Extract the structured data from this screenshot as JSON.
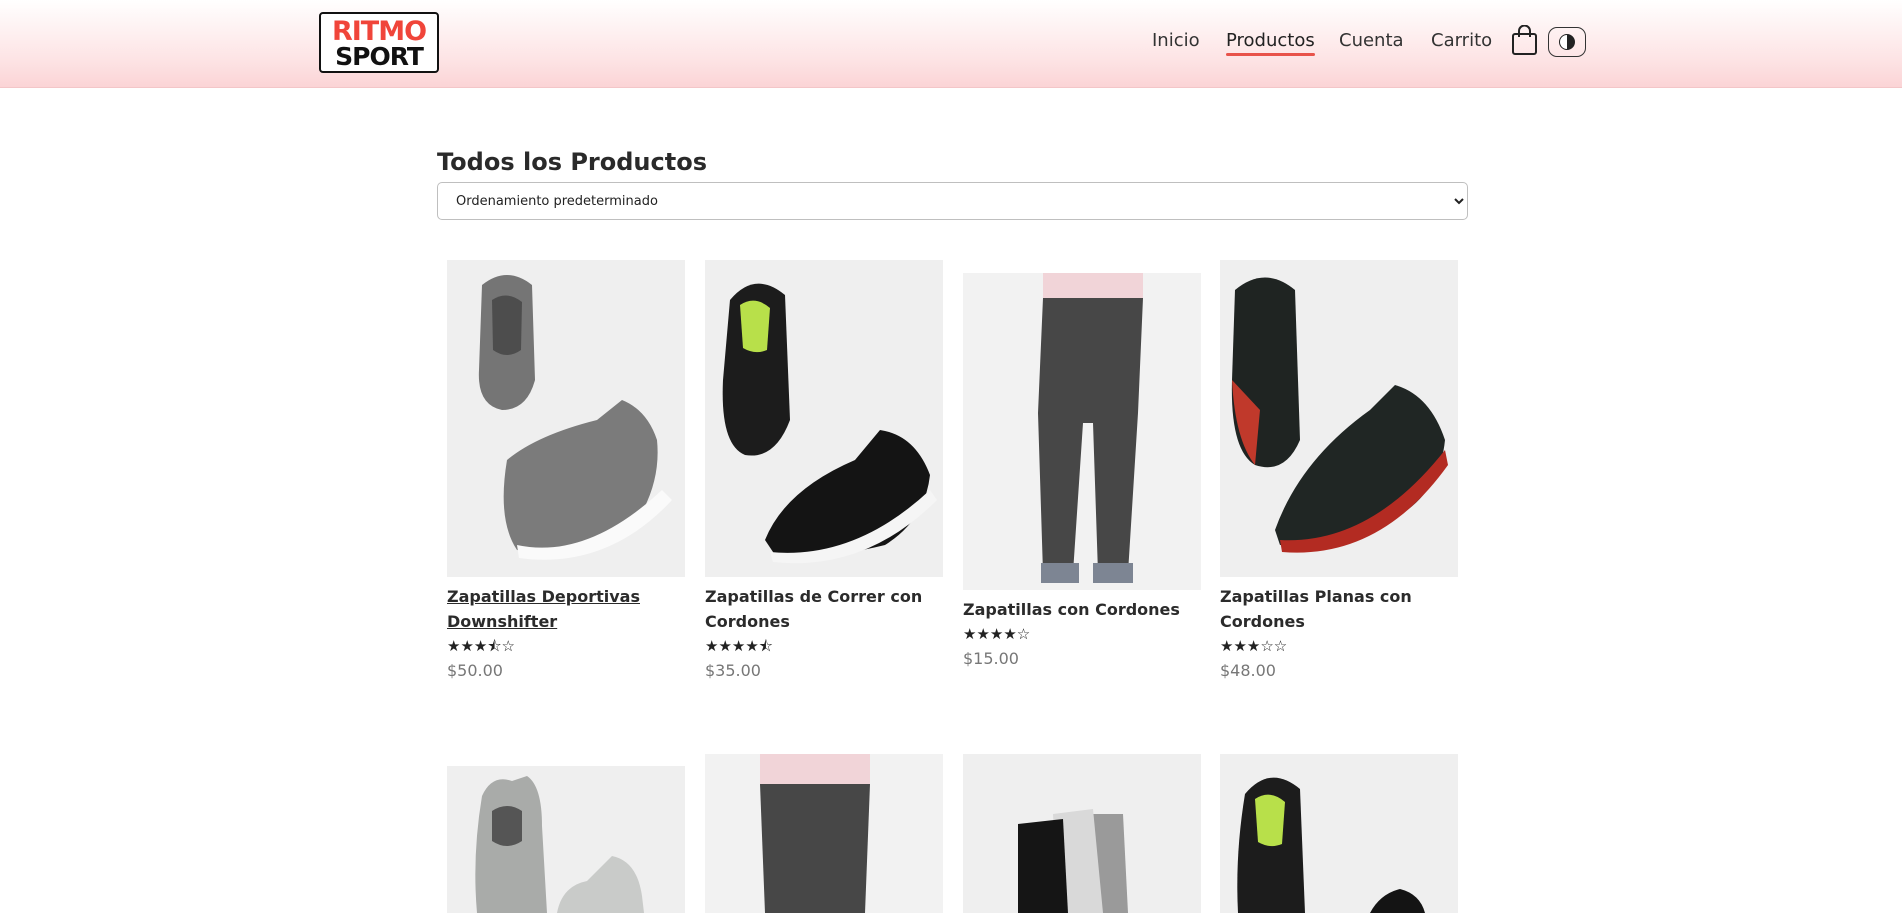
{
  "header": {
    "logo_top": "RITMO",
    "logo_bottom": "SPORT",
    "nav": [
      {
        "label": "Inicio"
      },
      {
        "label": "Productos"
      },
      {
        "label": "Cuenta"
      },
      {
        "label": "Carrito"
      }
    ],
    "bag_icon": "shopping-bag-icon",
    "theme_icon": "contrast-icon"
  },
  "main": {
    "title": "Todos los Productos",
    "sort": {
      "selected": "Ordenamiento predeterminado"
    },
    "products": [
      {
        "name": "Zapatillas Deportivas Downshifter",
        "rating": 3.5,
        "stars": "★★★⯪☆",
        "price": "$50.00",
        "image": "grey-slip-on-sneakers"
      },
      {
        "name": "Zapatillas de Correr con Cordones",
        "rating": 4.5,
        "stars": "★★★★⯪",
        "price": "$35.00",
        "image": "black-running-shoes"
      },
      {
        "name": "Zapatillas con Cordones",
        "rating": 4,
        "stars": "★★★★☆",
        "price": "$15.00",
        "image": "grey-trousers-model"
      },
      {
        "name": "Zapatillas Planas con Cordones",
        "rating": 3,
        "stars": "★★★☆☆",
        "price": "$48.00",
        "image": "black-red-trail-shoes"
      }
    ],
    "products_row2": [
      {
        "image": "grey-high-top-sneakers"
      },
      {
        "image": "grey-trousers-model"
      },
      {
        "image": "sport-socks"
      },
      {
        "image": "black-running-shoes"
      }
    ]
  }
}
